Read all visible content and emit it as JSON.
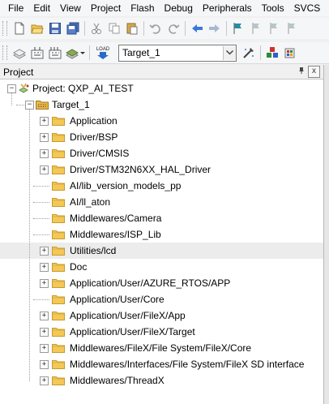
{
  "menu": [
    "File",
    "Edit",
    "View",
    "Project",
    "Flash",
    "Debug",
    "Peripherals",
    "Tools",
    "SVCS"
  ],
  "toolbar": {
    "target_value": "Target_1",
    "icons_row1": [
      "new-file-icon",
      "open-folder-icon",
      "save-icon",
      "save-all-icon",
      "cut-icon",
      "copy-icon",
      "paste-icon",
      "undo-icon",
      "redo-icon",
      "nav-back-icon",
      "nav-forward-icon",
      "bookmark-icon",
      "prev-bookmark-icon",
      "next-bookmark-icon",
      "clear-bookmarks-icon"
    ],
    "icons_row2": [
      "translate-icon",
      "build-icon",
      "rebuild-icon",
      "batch-build-icon",
      "download-icon",
      "target-options-icon",
      "manage-components-icon",
      "pack-installer-icon"
    ],
    "load_text": "LOAD"
  },
  "panel": {
    "title": "Project",
    "pin": "⬞",
    "close": "x"
  },
  "tree": {
    "project_label": "Project: QXP_AI_TEST",
    "target_label": "Target_1",
    "groups": [
      {
        "label": "Application",
        "expandable": true
      },
      {
        "label": "Driver/BSP",
        "expandable": true
      },
      {
        "label": "Driver/CMSIS",
        "expandable": true
      },
      {
        "label": "Driver/STM32N6XX_HAL_Driver",
        "expandable": true
      },
      {
        "label": "AI/lib_version_models_pp",
        "expandable": false
      },
      {
        "label": "AI/ll_aton",
        "expandable": false
      },
      {
        "label": "Middlewares/Camera",
        "expandable": false
      },
      {
        "label": "Middlewares/ISP_Lib",
        "expandable": false
      },
      {
        "label": "Utilities/lcd",
        "expandable": true,
        "selected": true
      },
      {
        "label": "Doc",
        "expandable": true
      },
      {
        "label": "Application/User/AZURE_RTOS/APP",
        "expandable": true
      },
      {
        "label": "Application/User/Core",
        "expandable": false
      },
      {
        "label": "Application/User/FileX/App",
        "expandable": true
      },
      {
        "label": "Application/User/FileX/Target",
        "expandable": true
      },
      {
        "label": "Middlewares/FileX/File System/FileX/Core",
        "expandable": true
      },
      {
        "label": "Middlewares/Interfaces/File System/FileX SD interface",
        "expandable": true
      },
      {
        "label": "Middlewares/ThreadX",
        "expandable": true
      }
    ]
  },
  "colors": {
    "folder_fill": "#f3c856",
    "folder_edge": "#c79a2c",
    "selection": "#ececec",
    "nav_arrow": "#3c78d8"
  }
}
